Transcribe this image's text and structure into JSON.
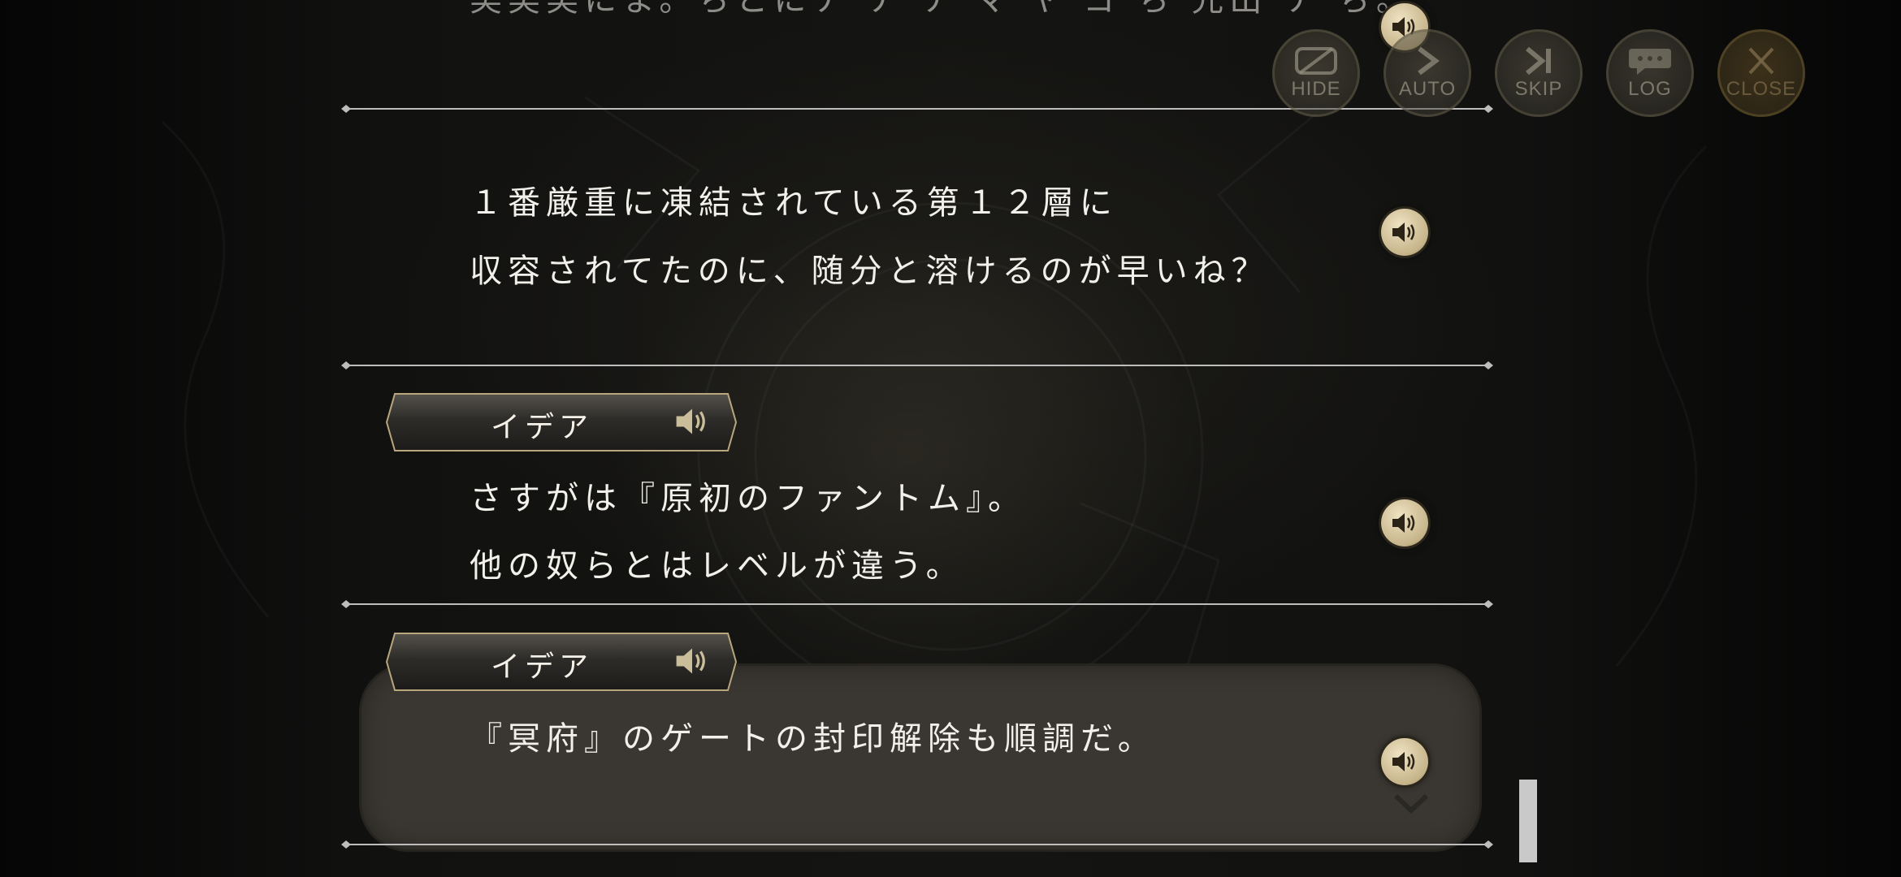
{
  "background": {
    "description_color": "#0b0b0a"
  },
  "colors": {
    "text": "#f2f0ea",
    "divider": "#bdbdbd",
    "voice_gold": "#c6b48a",
    "active_box": "#3a3732"
  },
  "entries": [
    {
      "lines": [
        "実実実にま。ちとにナ ナ ナ マ ヤ ヨ ち 先出 ナ ち。"
      ],
      "voice_icon": "speaker-icon"
    },
    {
      "lines": [
        "１番厳重に凍結されている第１２層に",
        "収容されてたのに、随分と溶けるのが早いね？"
      ],
      "voice_icon": "speaker-icon"
    },
    {
      "speaker": "イデア",
      "lines": [
        "さすがは『原初のファントム』。",
        "他の奴らとはレベルが違う。"
      ],
      "voice_icon": "speaker-icon"
    },
    {
      "speaker": "イデア",
      "lines": [
        "『冥府』のゲートの封印解除も順調だ。"
      ],
      "voice_icon": "speaker-icon",
      "active": true
    }
  ],
  "controls": {
    "hide": "HIDE",
    "auto": "AUTO",
    "skip": "SKIP",
    "log": "LOG",
    "close": "CLOSE"
  }
}
